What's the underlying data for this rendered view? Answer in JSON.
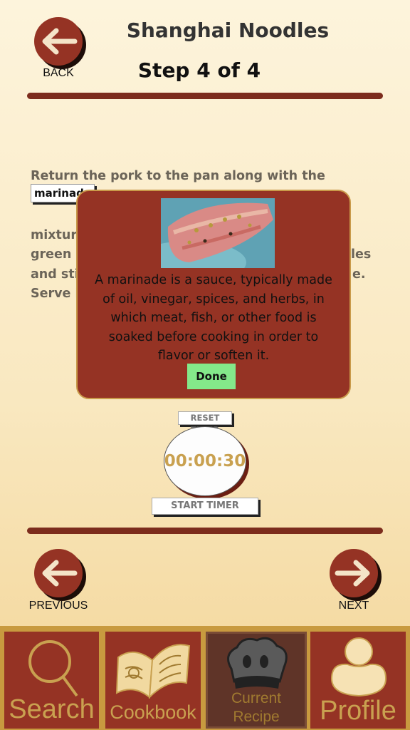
{
  "header": {
    "back_label": "BACK",
    "title": "Shanghai Noodles",
    "step": "Step 4 of 4"
  },
  "instructions": {
    "line1": "Return the pork to the pan along with the reserved",
    "highlight_word": "marinade",
    "line3": "mixture",
    "line4_start": "green c",
    "line4_end": "les",
    "line5_start": "and stir",
    "line5_end": "e.",
    "line6_start": "Serve in"
  },
  "popup": {
    "definition": "A marinade is a sauce, typically made of oil, vinegar, spices, and herbs, in which meat, fish, or other food is soaked before cooking in order to flavor or soften it.",
    "done_label": "Done"
  },
  "timer": {
    "reset_label": "RESET TIMER",
    "time": "00:00:30",
    "start_label": "START TIMER"
  },
  "navigation": {
    "previous_label": "PREVIOUS",
    "next_label": "NEXT"
  },
  "tabs": [
    {
      "label": "Search",
      "icon": "search-icon"
    },
    {
      "label": "Cookbook",
      "icon": "book-icon"
    },
    {
      "label_line1": "Current",
      "label_line2": "Recipe",
      "icon": "chef-hat-icon",
      "active": true
    },
    {
      "label": "Profile",
      "icon": "user-icon"
    }
  ],
  "colors": {
    "brand": "#953324",
    "accent": "#c89a3f",
    "done": "#84e88a"
  }
}
